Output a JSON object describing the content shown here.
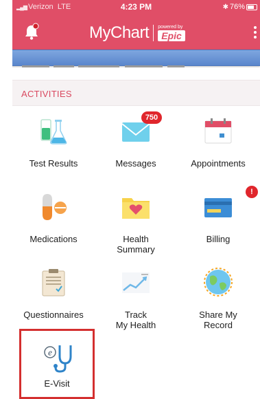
{
  "status_bar": {
    "carrier": "Verizon",
    "network": "LTE",
    "time": "4:23 PM",
    "battery_percent": "76%"
  },
  "header": {
    "logo_text": "MyChart",
    "powered_by": "powered by",
    "brand": "Epic"
  },
  "section": {
    "title": "ACTIVITIES"
  },
  "tiles": [
    {
      "label": "Test Results",
      "icon": "test-tubes-icon"
    },
    {
      "label": "Messages",
      "icon": "envelope-icon",
      "badge": "750"
    },
    {
      "label": "Appointments",
      "icon": "calendar-icon"
    },
    {
      "label": "Medications",
      "icon": "pill-icon"
    },
    {
      "label": "Health\nSummary",
      "icon": "folder-heart-icon"
    },
    {
      "label": "Billing",
      "icon": "credit-card-icon",
      "badge": "!"
    },
    {
      "label": "Questionnaires",
      "icon": "clipboard-icon"
    },
    {
      "label": "Track\nMy Health",
      "icon": "chart-icon"
    },
    {
      "label": "Share My\nRecord",
      "icon": "globe-icon"
    }
  ],
  "evisit": {
    "label": "E-Visit",
    "icon": "stethoscope-e-icon"
  },
  "colors": {
    "brand": "#e04e67",
    "section_text": "#d9485f",
    "highlight": "#d42f2f",
    "badge": "#e0262c"
  }
}
